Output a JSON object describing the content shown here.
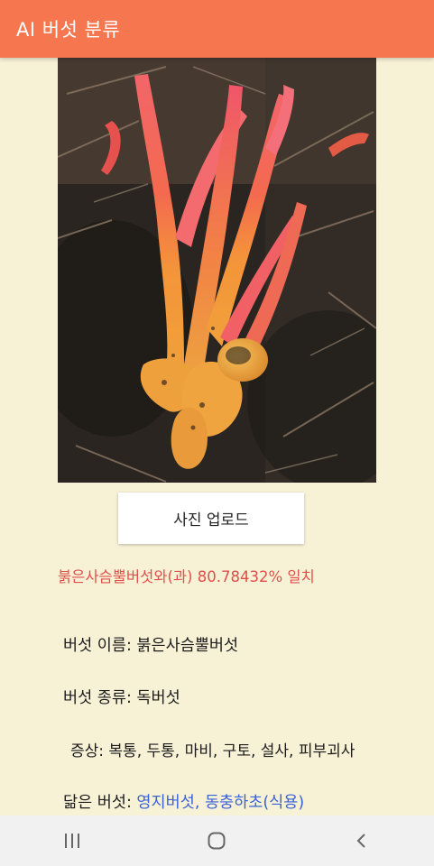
{
  "app_bar": {
    "title": "AI 버섯 분류",
    "color": "#f6774f"
  },
  "photo": {
    "subject": "orange-red mushroom on dark soil"
  },
  "upload_button": {
    "label": "사진 업로드"
  },
  "result": {
    "text": "붉은사슴뿔버섯와(과)  80.78432%  일치",
    "color": "#e0504a"
  },
  "info": {
    "name_label": "버섯 이름: ",
    "name_value": "붉은사슴뿔버섯",
    "type_label": "버섯 종류: ",
    "type_value": "독버섯",
    "symptoms_label": "증상: ",
    "symptoms_value": "복통, 두통, 마비, 구토, 설사, 피부괴사",
    "similar_label": "닮은 버섯: ",
    "similar_value": "영지버섯, 동충하초(식용)",
    "similar_color": "#3a62d8"
  },
  "nav": {
    "recent_icon": "recent-apps-icon",
    "home_icon": "home-icon",
    "back_icon": "back-icon"
  }
}
